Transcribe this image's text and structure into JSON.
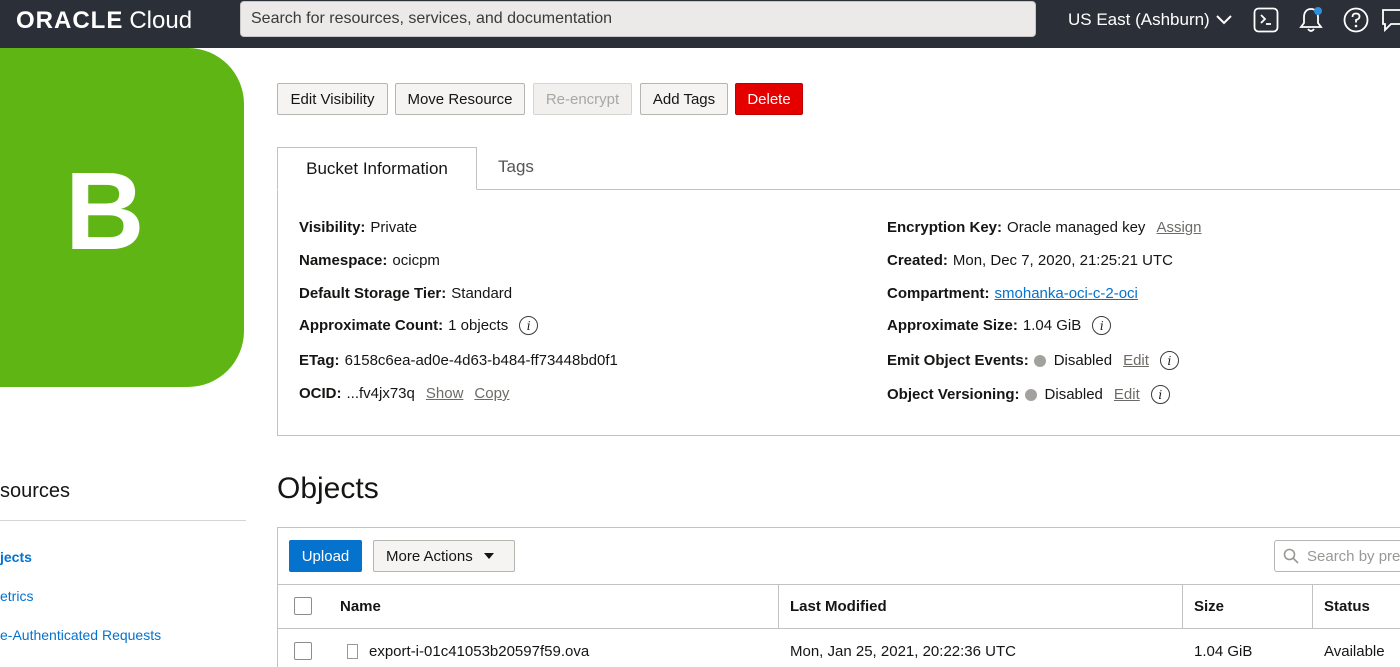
{
  "topbar": {
    "logo_oracle": "ORACLE",
    "logo_cloud": "Cloud",
    "search_placeholder": "Search for resources, services, and documentation",
    "region": "US East (Ashburn)"
  },
  "bucket": {
    "avatar_letter": "B"
  },
  "actions": {
    "edit_visibility": "Edit Visibility",
    "move_resource": "Move Resource",
    "re_encrypt": "Re-encrypt",
    "add_tags": "Add Tags",
    "delete": "Delete"
  },
  "tabs": {
    "bucket_information": "Bucket Information",
    "tags": "Tags"
  },
  "info_left": {
    "visibility_label": "Visibility:",
    "visibility_value": "Private",
    "namespace_label": "Namespace:",
    "namespace_value": "ocicpm",
    "storage_tier_label": "Default Storage Tier:",
    "storage_tier_value": "Standard",
    "approx_count_label": "Approximate Count:",
    "approx_count_value": "1 objects",
    "etag_label": "ETag:",
    "etag_value": "6158c6ea-ad0e-4d63-b484-ff73448bd0f1",
    "ocid_label": "OCID:",
    "ocid_value": "...fv4jx73q",
    "show_link": "Show",
    "copy_link": "Copy"
  },
  "info_right": {
    "encryption_label": "Encryption Key:",
    "encryption_value": "Oracle managed key",
    "assign_link": "Assign",
    "created_label": "Created:",
    "created_value": "Mon, Dec 7, 2020, 21:25:21 UTC",
    "compartment_label": "Compartment:",
    "compartment_value": "smohanka-oci-c-2-oci",
    "approx_size_label": "Approximate Size:",
    "approx_size_value": "1.04 GiB",
    "emit_events_label": "Emit Object Events:",
    "emit_events_value": "Disabled",
    "emit_edit_link": "Edit",
    "versioning_label": "Object Versioning:",
    "versioning_value": "Disabled",
    "versioning_edit_link": "Edit"
  },
  "sidebar": {
    "title": "sources",
    "items": [
      {
        "label": "jects"
      },
      {
        "label": "etrics"
      },
      {
        "label": "e-Authenticated Requests"
      }
    ]
  },
  "objects": {
    "title": "Objects",
    "upload": "Upload",
    "more_actions": "More Actions",
    "search_placeholder": "Search by pre",
    "columns": [
      "Name",
      "Last Modified",
      "Size",
      "Status"
    ],
    "rows": [
      {
        "name": "export-i-01c41053b20597f59.ova",
        "last_modified": "Mon, Jan 25, 2021, 20:22:36 UTC",
        "size": "1.04 GiB",
        "status": "Available"
      }
    ]
  }
}
